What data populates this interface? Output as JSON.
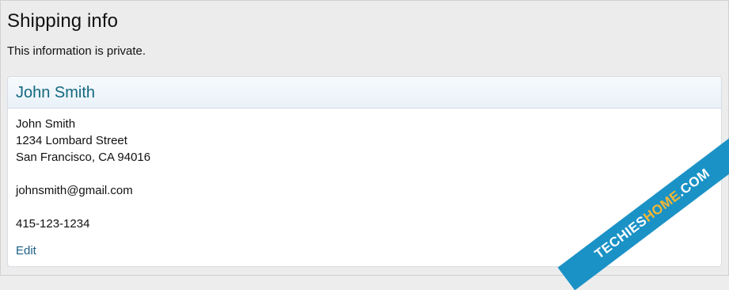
{
  "page": {
    "title": "Shipping info",
    "subtitle": "This information is private."
  },
  "panel": {
    "header_name": "John Smith",
    "address_lines": [
      "John Smith",
      "1234 Lombard Street",
      "San Francisco, CA 94016"
    ],
    "email": "johnsmith@gmail.com",
    "phone": "415-123-1234",
    "edit_label": "Edit"
  },
  "watermark": {
    "part1": "TECHIES",
    "part2": "HOME",
    "part3": ".COM"
  },
  "colors": {
    "link": "#12687f",
    "watermark_bg": "#1b92c6",
    "watermark_accent": "#f7b733"
  }
}
